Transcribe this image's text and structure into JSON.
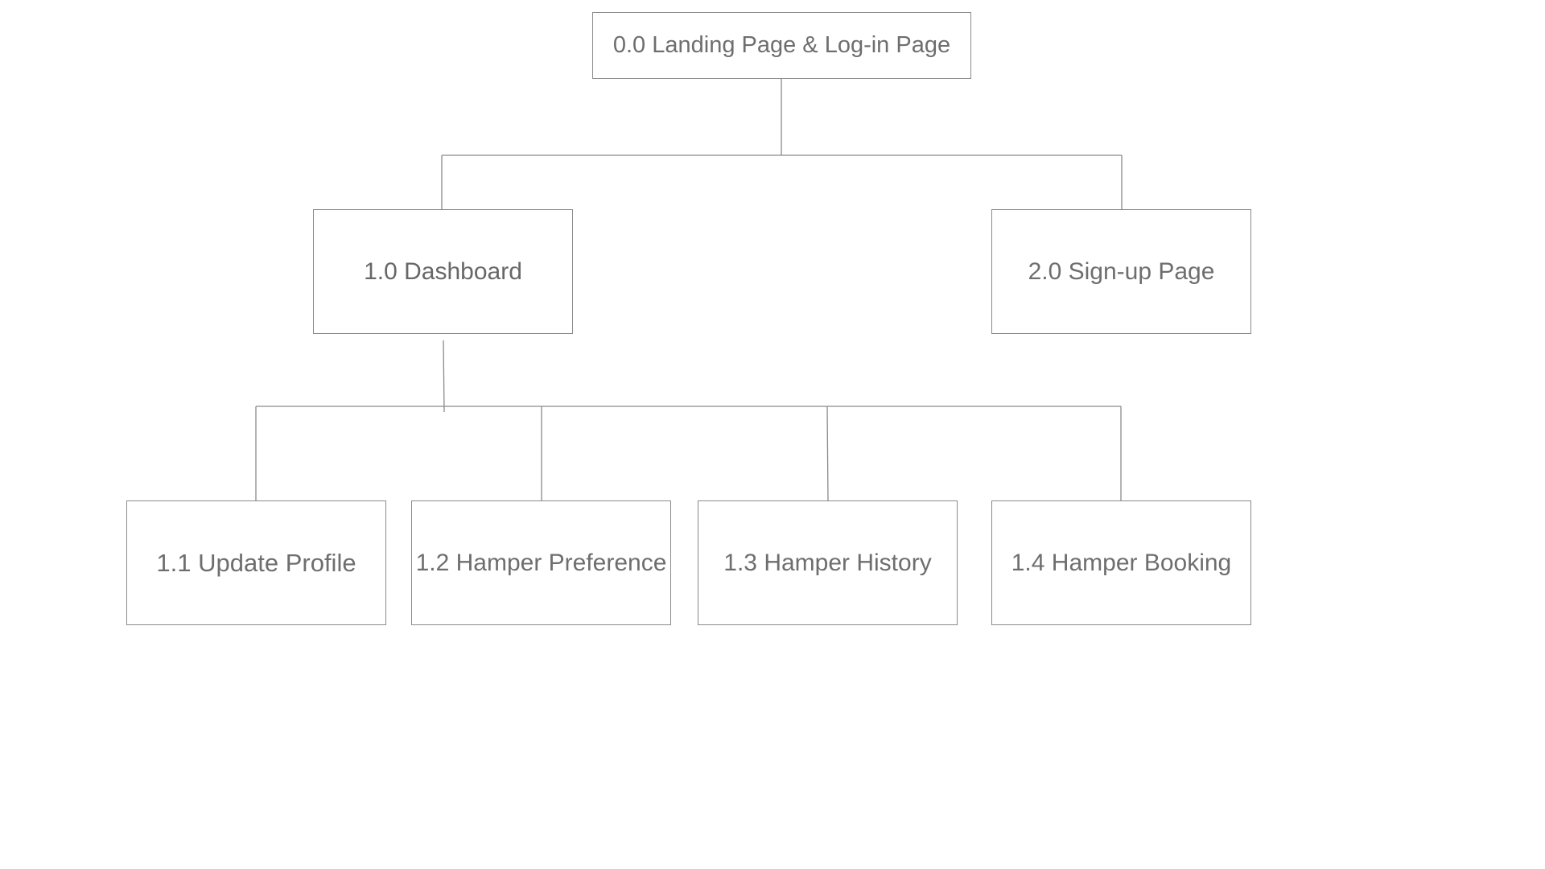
{
  "diagram": {
    "root": {
      "label": "0.0 Landing Page & Log-in Page"
    },
    "level1": [
      {
        "label": "1.0 Dashboard"
      },
      {
        "label": "2.0 Sign-up Page"
      }
    ],
    "level2": [
      {
        "label": "1.1 Update Profile"
      },
      {
        "label": "1.2 Hamper Preference"
      },
      {
        "label": "1.3 Hamper History"
      },
      {
        "label": "1.4 Hamper Booking"
      }
    ]
  },
  "colors": {
    "line": "#8a8a8a",
    "text": "#6e6e6e",
    "background": "#ffffff"
  }
}
